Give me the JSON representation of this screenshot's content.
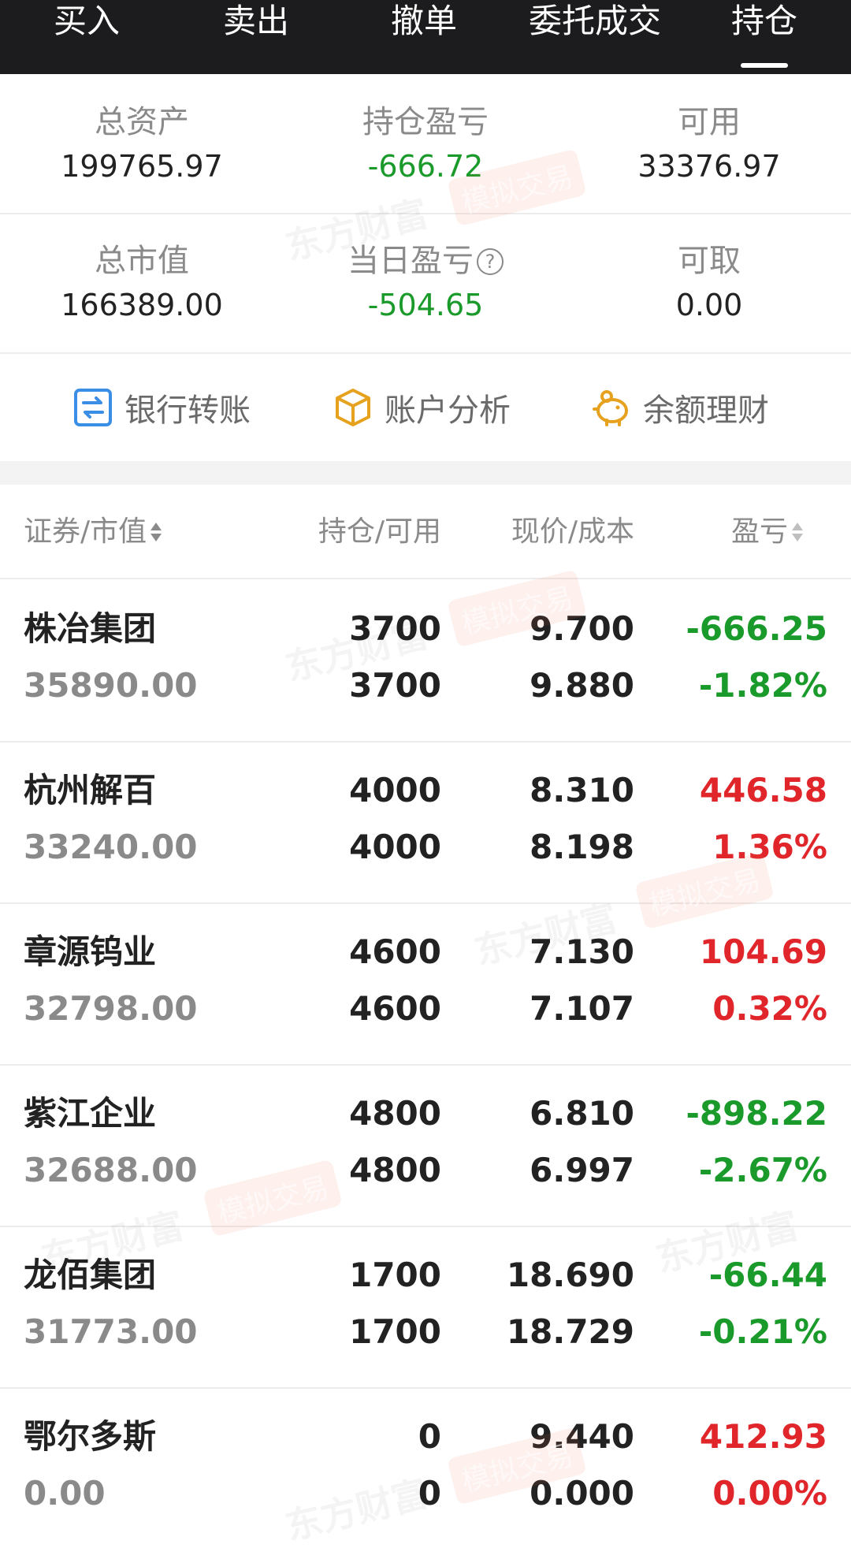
{
  "tabs": [
    {
      "label": "买入"
    },
    {
      "label": "卖出"
    },
    {
      "label": "撤单"
    },
    {
      "label": "委托成交"
    },
    {
      "label": "持仓"
    }
  ],
  "summary": {
    "total_assets": {
      "label": "总资产",
      "value": "199765.97"
    },
    "position_pl": {
      "label": "持仓盈亏",
      "value": "-666.72"
    },
    "available": {
      "label": "可用",
      "value": "33376.97"
    },
    "total_market_value": {
      "label": "总市值",
      "value": "166389.00"
    },
    "daily_pl": {
      "label": "当日盈亏",
      "value": "-504.65"
    },
    "withdrawable": {
      "label": "可取",
      "value": "0.00"
    }
  },
  "actions": [
    {
      "label": "银行转账",
      "icon": "bank-transfer-icon"
    },
    {
      "label": "账户分析",
      "icon": "cube-icon"
    },
    {
      "label": "余额理财",
      "icon": "piggy-bank-icon"
    }
  ],
  "table": {
    "headers": {
      "security": "证券/市值",
      "position": "持仓/可用",
      "price": "现价/成本",
      "pl": "盈亏"
    },
    "rows": [
      {
        "name": "株冶集团",
        "market_value": "35890.00",
        "position": "3700",
        "available": "3700",
        "price": "9.700",
        "cost": "9.880",
        "pl": "-666.25",
        "pl_pct": "-1.82%",
        "trend": "down"
      },
      {
        "name": "杭州解百",
        "market_value": "33240.00",
        "position": "4000",
        "available": "4000",
        "price": "8.310",
        "cost": "8.198",
        "pl": "446.58",
        "pl_pct": "1.36%",
        "trend": "up"
      },
      {
        "name": "章源钨业",
        "market_value": "32798.00",
        "position": "4600",
        "available": "4600",
        "price": "7.130",
        "cost": "7.107",
        "pl": "104.69",
        "pl_pct": "0.32%",
        "trend": "up"
      },
      {
        "name": "紫江企业",
        "market_value": "32688.00",
        "position": "4800",
        "available": "4800",
        "price": "6.810",
        "cost": "6.997",
        "pl": "-898.22",
        "pl_pct": "-2.67%",
        "trend": "down"
      },
      {
        "name": "龙佰集团",
        "market_value": "31773.00",
        "position": "1700",
        "available": "1700",
        "price": "18.690",
        "cost": "18.729",
        "pl": "-66.44",
        "pl_pct": "-0.21%",
        "trend": "down"
      },
      {
        "name": "鄂尔多斯",
        "market_value": "0.00",
        "position": "0",
        "available": "0",
        "price": "9.440",
        "cost": "0.000",
        "pl": "412.93",
        "pl_pct": "0.00%",
        "trend": "up"
      }
    ]
  },
  "watermark": {
    "brand": "东方财富",
    "tag": "模拟交易"
  },
  "colors": {
    "up": "#e0262b",
    "down": "#1a9a2a",
    "topbar": "#1c1c1e"
  }
}
